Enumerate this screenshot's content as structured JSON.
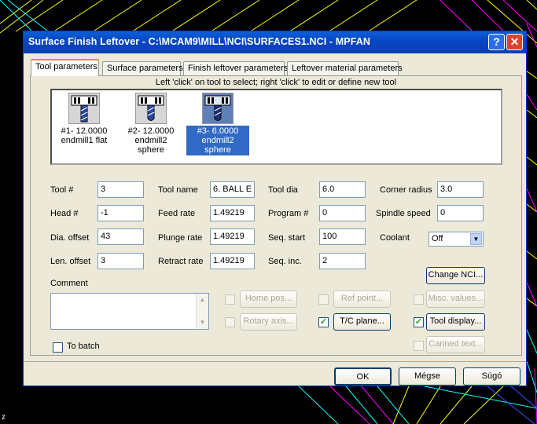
{
  "window": {
    "title": "Surface Finish Leftover - C:\\MCAM9\\MILL\\NCI\\SURFACES1.NCI - MPFAN",
    "help_glyph": "?",
    "close_glyph": "✕"
  },
  "tabs": [
    {
      "label": "Tool parameters",
      "active": true
    },
    {
      "label": "Surface parameters",
      "active": false
    },
    {
      "label": "Finish leftover parameters",
      "active": false
    },
    {
      "label": "Leftover material parameters",
      "active": false
    }
  ],
  "hint": "Left 'click' on tool to select; right 'click' to edit or define new tool",
  "tools": [
    {
      "line1": "#1- 12.0000",
      "line2": "endmill1 flat",
      "icon": "flat-endmill-icon",
      "selected": false
    },
    {
      "line1": "#2- 12.0000",
      "line2": "endmill2 sphere",
      "icon": "ball-endmill-icon",
      "selected": false
    },
    {
      "line1": "#3- 6.0000",
      "line2": "endmill2 sphere",
      "icon": "ball-endmill-icon",
      "selected": true
    }
  ],
  "fields": {
    "tool_num": {
      "label": "Tool #",
      "value": "3"
    },
    "head_num": {
      "label": "Head #",
      "value": "-1"
    },
    "dia_offset": {
      "label": "Dia. offset",
      "value": "43"
    },
    "len_offset": {
      "label": "Len. offset",
      "value": "3"
    },
    "tool_name": {
      "label": "Tool name",
      "value": "6. BALL E"
    },
    "feed_rate": {
      "label": "Feed rate",
      "value": "1.49219"
    },
    "plunge_rate": {
      "label": "Plunge rate",
      "value": "1.49219"
    },
    "retract_rate": {
      "label": "Retract rate",
      "value": "1.49219"
    },
    "tool_dia": {
      "label": "Tool dia",
      "value": "6.0"
    },
    "program_num": {
      "label": "Program #",
      "value": "0"
    },
    "seq_start": {
      "label": "Seq. start",
      "value": "100"
    },
    "seq_inc": {
      "label": "Seq. inc.",
      "value": "2"
    },
    "corner_radius": {
      "label": "Corner radius",
      "value": "3.0"
    },
    "spindle_speed": {
      "label": "Spindle speed",
      "value": "0"
    },
    "coolant": {
      "label": "Coolant",
      "value": "Off"
    }
  },
  "comment": {
    "label": "Comment",
    "value": ""
  },
  "buttons": {
    "change_nci": "Change NCI...",
    "home_pos": "Home pos...",
    "rotary_axis": "Rotary axis...",
    "ref_point": "Ref point...",
    "tc_plane": "T/C plane...",
    "misc_values": "Misc. values...",
    "tool_display": "Tool display...",
    "canned_text": "Canned text...",
    "ok": "OK",
    "cancel": "Mégse",
    "help": "Súgó"
  },
  "checkboxes": {
    "home_pos": false,
    "rotary_axis": false,
    "ref_point": false,
    "tc_plane": true,
    "misc_values": false,
    "tool_display": true,
    "canned_text": false,
    "to_batch": false
  },
  "to_batch_label": "To batch",
  "stray_label": "z",
  "colors": {
    "title_bar": "#0a4fc8",
    "selection": "#316ac5",
    "dialog_bg": "#ece9d8",
    "bg_lines": [
      "#ffff00",
      "#ff00ff",
      "#00ffff"
    ]
  }
}
